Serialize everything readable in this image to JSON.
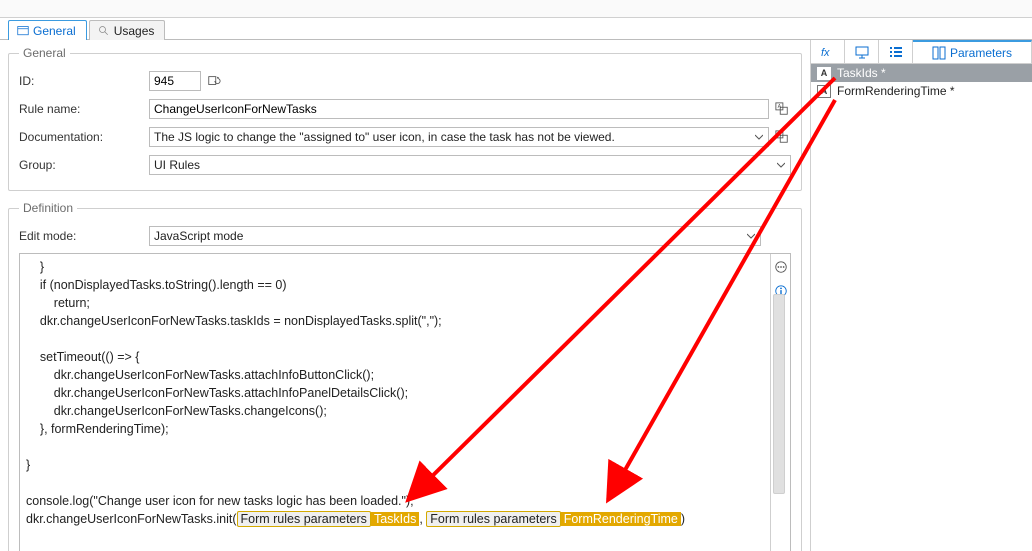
{
  "tabs": {
    "general": "General",
    "usages": "Usages"
  },
  "groups": {
    "general": "General",
    "definition": "Definition"
  },
  "labels": {
    "id": "ID:",
    "rule_name": "Rule name:",
    "documentation": "Documentation:",
    "group": "Group:",
    "edit_mode": "Edit mode:"
  },
  "values": {
    "id": "945",
    "rule_name": "ChangeUserIconForNewTasks",
    "documentation": "The JS logic to change the \"assigned to\" user icon, in case the task has not be viewed.",
    "group": "UI Rules",
    "edit_mode": "JavaScript mode"
  },
  "code": {
    "l1": "    }",
    "l2": "    if (nonDisplayedTasks.toString().length == 0)",
    "l3": "        return;",
    "l4": "    dkr.changeUserIconForNewTasks.taskIds = nonDisplayedTasks.split(\",\");",
    "l5": "",
    "l6": "    setTimeout(() => {",
    "l7": "        dkr.changeUserIconForNewTasks.attachInfoButtonClick();",
    "l8": "        dkr.changeUserIconForNewTasks.attachInfoPanelDetailsClick();",
    "l9": "        dkr.changeUserIconForNewTasks.changeIcons();",
    "l10": "    }, formRenderingTime);",
    "l11": "",
    "l12": "}",
    "l13": "",
    "l14": "console.log(\"Change user icon for new tasks logic has been loaded.\");",
    "l15_a": "dkr.changeUserIconForNewTasks.init(",
    "l15_p1g": "Form rules parameters",
    "l15_p1a": "TaskIds",
    "l15_sep": ", ",
    "l15_p2g": "Form rules parameters",
    "l15_p2a": "FormRenderingTime",
    "l15_b": ")"
  },
  "right_tabs": {
    "parameters": "Parameters"
  },
  "params": {
    "p1": "TaskIds *",
    "p2": "FormRenderingTime *"
  }
}
